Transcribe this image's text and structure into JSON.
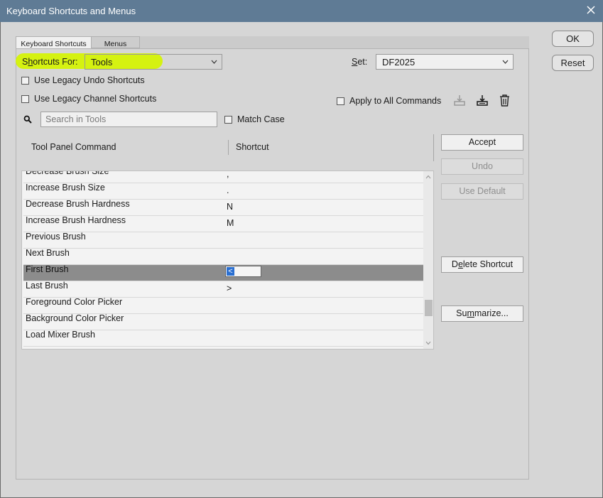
{
  "window": {
    "title": "Keyboard Shortcuts and Menus"
  },
  "tabs": [
    {
      "label": "Keyboard Shortcuts"
    },
    {
      "label": "Menus"
    }
  ],
  "shortcuts_for": {
    "label_pre": "S",
    "label_ul": "h",
    "label_post": "ortcuts For:",
    "value": "Tools"
  },
  "set": {
    "label_ul": "S",
    "label_post": "et:",
    "value": "DF2025"
  },
  "options": {
    "legacy_undo": "Use Legacy Undo Shortcuts",
    "legacy_channel": "Use Legacy Channel Shortcuts",
    "apply_all": "Apply to All Commands",
    "match_case": "Match Case"
  },
  "search": {
    "placeholder": "Search in Tools"
  },
  "table": {
    "col_command": "Tool Panel Command",
    "col_shortcut": "Shortcut",
    "rows": [
      {
        "command": "Decrease Brush Size",
        "shortcut": ","
      },
      {
        "command": "Increase Brush Size",
        "shortcut": "."
      },
      {
        "command": "Decrease Brush Hardness",
        "shortcut": "N"
      },
      {
        "command": "Increase Brush Hardness",
        "shortcut": "M"
      },
      {
        "command": "Previous Brush",
        "shortcut": ""
      },
      {
        "command": "Next Brush",
        "shortcut": ""
      },
      {
        "command": "First Brush",
        "shortcut": "<"
      },
      {
        "command": "Last Brush",
        "shortcut": ">"
      },
      {
        "command": "Foreground Color Picker",
        "shortcut": ""
      },
      {
        "command": "Background Color Picker",
        "shortcut": ""
      },
      {
        "command": "Load Mixer Brush",
        "shortcut": ""
      }
    ]
  },
  "buttons": {
    "accept": "Accept",
    "undo": "Undo",
    "use_default": "Use Default",
    "delete_pre": "D",
    "delete_ul": "e",
    "delete_post": "lete Shortcut",
    "summarize_pre": "Su",
    "summarize_ul": "m",
    "summarize_post": "marize...",
    "ok": "OK",
    "reset": "Reset"
  }
}
